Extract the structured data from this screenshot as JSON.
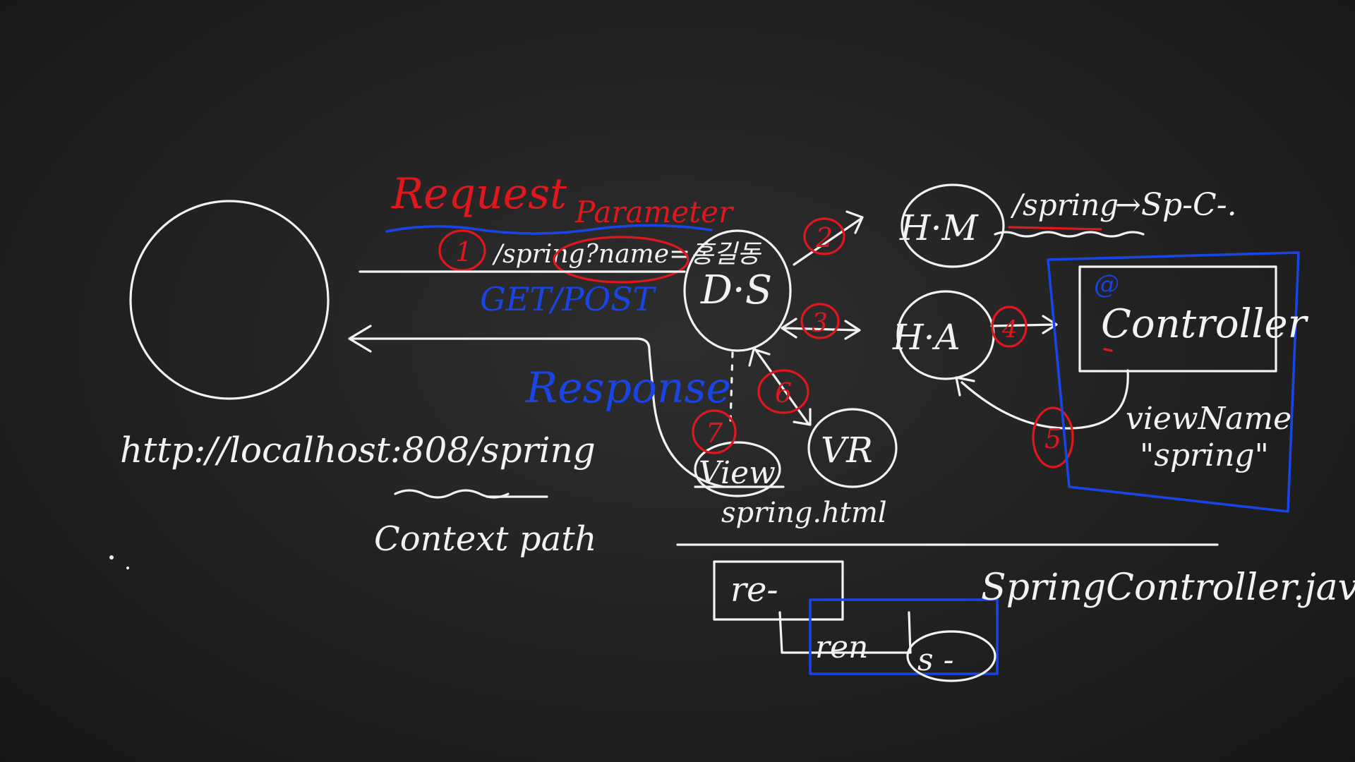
{
  "labels": {
    "request": "Request",
    "parameter": "Parameter",
    "url_query": "/spring?name=홍길동",
    "method": "GET/POST",
    "response": "Response",
    "url": "http://localhost:808/spring",
    "context_path": "Context path",
    "ds": "D·S",
    "hm": "H·M",
    "ha": "H·A",
    "vr": "VR",
    "view": "View",
    "view_file": "spring.html",
    "mapping": "/spring",
    "mapping_arrow": "→Sp-C-.",
    "annotation": "@",
    "controller": "Controller",
    "view_name": "viewName",
    "view_name_value": "\"spring\"",
    "controller_file": "SpringController.java",
    "box_re": "re-",
    "box_ren": "ren",
    "box_s": "s -"
  },
  "steps": {
    "s1": "1",
    "s2": "2",
    "s3": "3",
    "s4": "4",
    "s5": "5",
    "s6": "6",
    "s7": "7"
  },
  "colors": {
    "board": "#232323",
    "chalk_white": "#f2f2f2",
    "chalk_red": "#e0181e",
    "chalk_blue": "#1a45e6"
  }
}
